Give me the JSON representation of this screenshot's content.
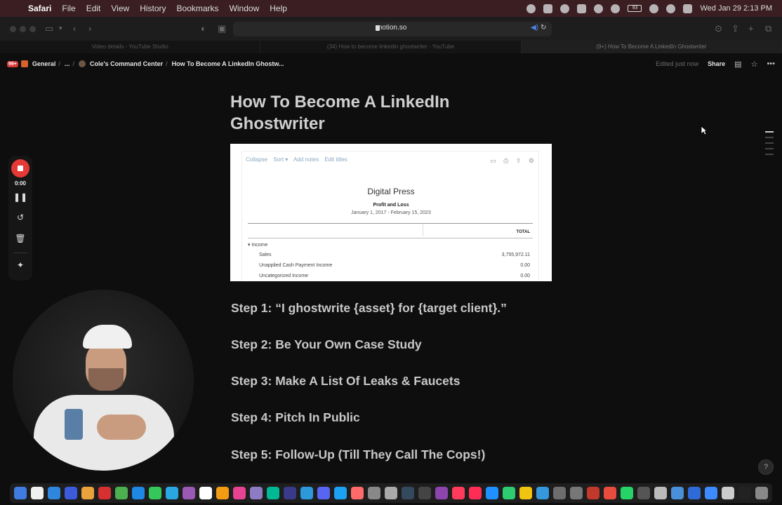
{
  "menubar": {
    "apple_glyph": "",
    "items": [
      "Safari",
      "File",
      "Edit",
      "View",
      "History",
      "Bookmarks",
      "Window",
      "Help"
    ],
    "datetime": "Wed Jan 29  2:13 PM",
    "battery": "93"
  },
  "toolbar": {
    "url": "notion.so"
  },
  "tabs": [
    "Video details - YouTube Studio",
    "(34) How to become linkedin ghostwriter - YouTube",
    "(9+) How To Become A LinkedIn Ghostwriter"
  ],
  "notion": {
    "badge": "99+",
    "breadcrumbs": [
      "General",
      "...",
      "Cole's Command Center",
      "How To Become A LinkedIn Ghostw..."
    ],
    "edited": "Edited just now",
    "share": "Share",
    "title": "How To Become A LinkedIn Ghostwriter"
  },
  "report": {
    "tools": [
      "Collapse",
      "Sort ▾",
      "Add notes",
      "Edit titles"
    ],
    "company": "Digital Press",
    "name": "Profit and Loss",
    "range": "January 1, 2017 - February 15, 2023",
    "total_header": "TOTAL",
    "rows": [
      {
        "label": "▾ Income",
        "value": ""
      },
      {
        "label": "Sales",
        "value": "3,755,972.11"
      },
      {
        "label": "Unapplied Cash Payment Income",
        "value": "0.00"
      },
      {
        "label": "Uncategorized Income",
        "value": "0.00"
      }
    ]
  },
  "steps": [
    "Step 1: “I ghostwrite {asset} for {target client}.”",
    "Step 2: Be Your Own Case Study",
    "Step 3: Make A List Of Leaks & Faucets",
    "Step 4: Pitch In Public",
    "Step 5: Follow-Up (Till They Call The Cops!)"
  ],
  "recorder": {
    "time": "0:00"
  },
  "help_glyph": "?",
  "dock_colors": [
    "#3f7be0",
    "#f0f0f0",
    "#2e86de",
    "#3b5bdb",
    "#e8a33d",
    "#d63031",
    "#4caf50",
    "#1e88e5",
    "#34c759",
    "#2aa7e0",
    "#9b59b6",
    "#ffffff",
    "#f39c12",
    "#e84393",
    "#8e7cc3",
    "#00b894",
    "#3a3a8a",
    "#2d98da",
    "#5865f2",
    "#1da1f2",
    "#ff6b6b",
    "#888888",
    "#aaaaaa",
    "#34495e",
    "#444444",
    "#8e44ad",
    "#ff3b5c",
    "#ff2d55",
    "#1e90ff",
    "#2ecc71",
    "#f1c40f",
    "#3498db",
    "#6d6d6d",
    "#777777",
    "#c0392b",
    "#e74c3c",
    "#25d366",
    "#555555",
    "#bbbbbb",
    "#4a90d9",
    "#2f6bd8",
    "#3d8bfd",
    "#cccccc",
    "#222222",
    "#888888"
  ]
}
